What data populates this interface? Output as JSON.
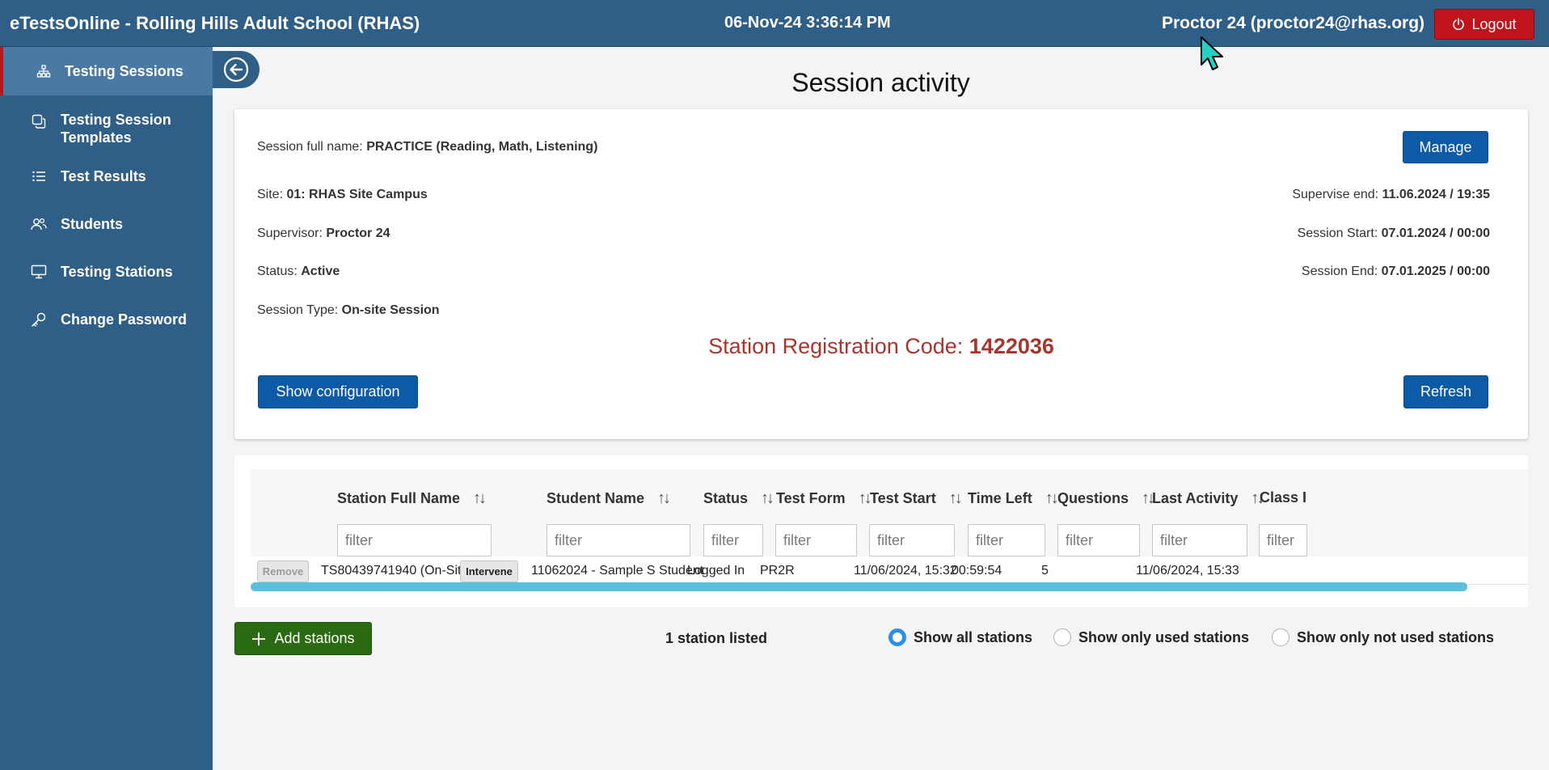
{
  "header": {
    "app_title": "eTestsOnline - Rolling Hills Adult School (RHAS)",
    "datetime": "06-Nov-24 3:36:14 PM",
    "user": "Proctor 24 (proctor24@rhas.org)",
    "logout_label": "Logout"
  },
  "sidebar": {
    "items": [
      {
        "label": "Testing Sessions",
        "icon": "sitemap-icon"
      },
      {
        "label": "Testing Session Templates",
        "icon": "copy-icon"
      },
      {
        "label": "Test Results",
        "icon": "list-icon"
      },
      {
        "label": "Students",
        "icon": "users-icon"
      },
      {
        "label": "Testing Stations",
        "icon": "monitor-icon"
      },
      {
        "label": "Change Password",
        "icon": "key-icon"
      }
    ]
  },
  "page": {
    "title": "Session activity"
  },
  "session": {
    "full_name_label": "Session full name: ",
    "full_name": "PRACTICE (Reading, Math, Listening)",
    "site_label": "Site: ",
    "site": "01: RHAS Site Campus",
    "supervisor_label": "Supervisor: ",
    "supervisor": "Proctor 24",
    "status_label": "Status: ",
    "status": "Active",
    "type_label": "Session Type: ",
    "type": "On-site Session",
    "supervise_end_label": "Supervise end: ",
    "supervise_end": "11.06.2024 / 19:35",
    "session_start_label": "Session Start: ",
    "session_start": "07.01.2024 / 00:00",
    "session_end_label": "Session End: ",
    "session_end": "07.01.2025 / 00:00",
    "reg_code_label": "Station Registration Code: ",
    "reg_code": "1422036",
    "manage_label": "Manage",
    "show_config_label": "Show configuration",
    "refresh_label": "Refresh"
  },
  "table": {
    "columns": [
      "Station Full Name",
      "Student Name",
      "Status",
      "Test Form",
      "Test Start",
      "Time Left",
      "Questions",
      "Last Activity",
      "Class I"
    ],
    "filter_placeholder": "filter",
    "rows": [
      {
        "remove_label": "Remove",
        "station": "TS80439741940 (On-Site)",
        "intervene_label": "Intervene",
        "student": "11062024 - Sample S Student",
        "status": "Logged In",
        "test_form": "PR2R",
        "test_start": "11/06/2024, 15:32",
        "time_left": "00:59:54",
        "questions": "5",
        "last_activity": "11/06/2024, 15:33"
      }
    ]
  },
  "footer": {
    "add_label": "Add stations",
    "count_text": "1 station listed",
    "radio_options": [
      "Show all stations",
      "Show only used stations",
      "Show only not used stations"
    ],
    "selected_option": "Show all stations"
  },
  "colors": {
    "header_bg": "#2f5f86",
    "logout_bg": "#c0141d",
    "primary_button": "#0d5aa7",
    "add_button": "#2a6a12",
    "reg_code_text": "#a9362e",
    "scrollbar": "#5bc0de"
  }
}
